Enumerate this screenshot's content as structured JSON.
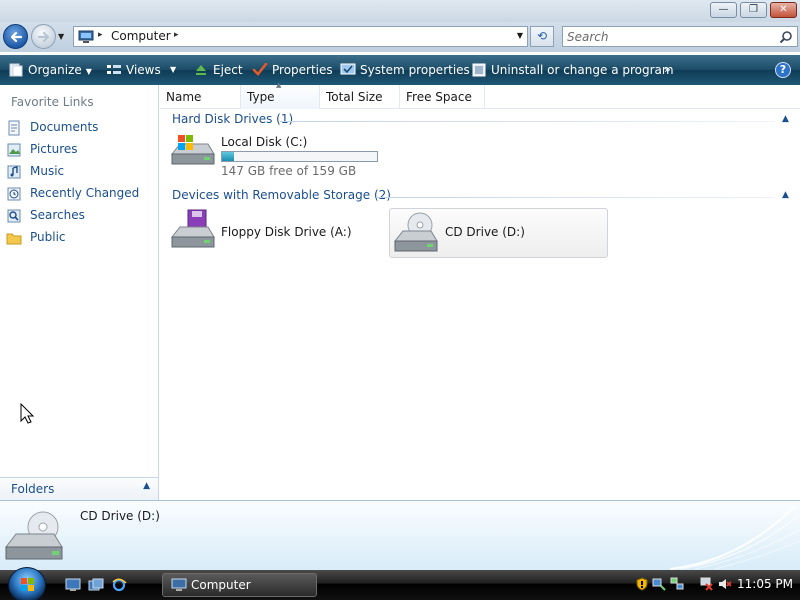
{
  "window": {
    "controls": {
      "minimize": "—",
      "maximize": "❐",
      "close": "✕"
    }
  },
  "address": {
    "crumb": "Computer",
    "arrow": "▸",
    "dropdown": "▼",
    "refresh": "⟲",
    "search_placeholder": "Search"
  },
  "commands": {
    "organize": "Organize",
    "views": "Views",
    "eject": "Eject",
    "properties": "Properties",
    "system_properties": "System properties",
    "uninstall": "Uninstall or change a program",
    "more": "»",
    "help": "?",
    "caret": "▼"
  },
  "navpane": {
    "favorites_title": "Favorite Links",
    "items": [
      {
        "label": "Documents",
        "icon": "documents-icon"
      },
      {
        "label": "Pictures",
        "icon": "pictures-icon"
      },
      {
        "label": "Music",
        "icon": "music-icon"
      },
      {
        "label": "Recently Changed",
        "icon": "recently-changed-icon"
      },
      {
        "label": "Searches",
        "icon": "searches-icon"
      },
      {
        "label": "Public",
        "icon": "public-folder-icon"
      }
    ],
    "folders_label": "Folders",
    "folders_toggle": "▲"
  },
  "content": {
    "columns": [
      "Name",
      "Type",
      "Total Size",
      "Free Space"
    ],
    "sort_indicator": "▲",
    "groups": [
      {
        "title": "Hard Disk Drives (1)",
        "toggle": "▲",
        "drives": [
          {
            "name": "Local Disk (C:)",
            "free_text": "147 GB free of 159 GB",
            "used_fraction": 0.075
          }
        ]
      },
      {
        "title": "Devices with Removable Storage (2)",
        "toggle": "▲",
        "drives": [
          {
            "name": "Floppy Disk Drive (A:)"
          },
          {
            "name": "CD Drive (D:)",
            "selected": true
          }
        ]
      }
    ]
  },
  "details": {
    "title": "CD Drive (D:)"
  },
  "taskbar": {
    "task_label": "Computer",
    "clock": "11:05 PM"
  },
  "colors": {
    "link_blue": "#1a4f8f",
    "command_bar": "#1b4b66",
    "capacity_fill": "#1a8eae"
  }
}
